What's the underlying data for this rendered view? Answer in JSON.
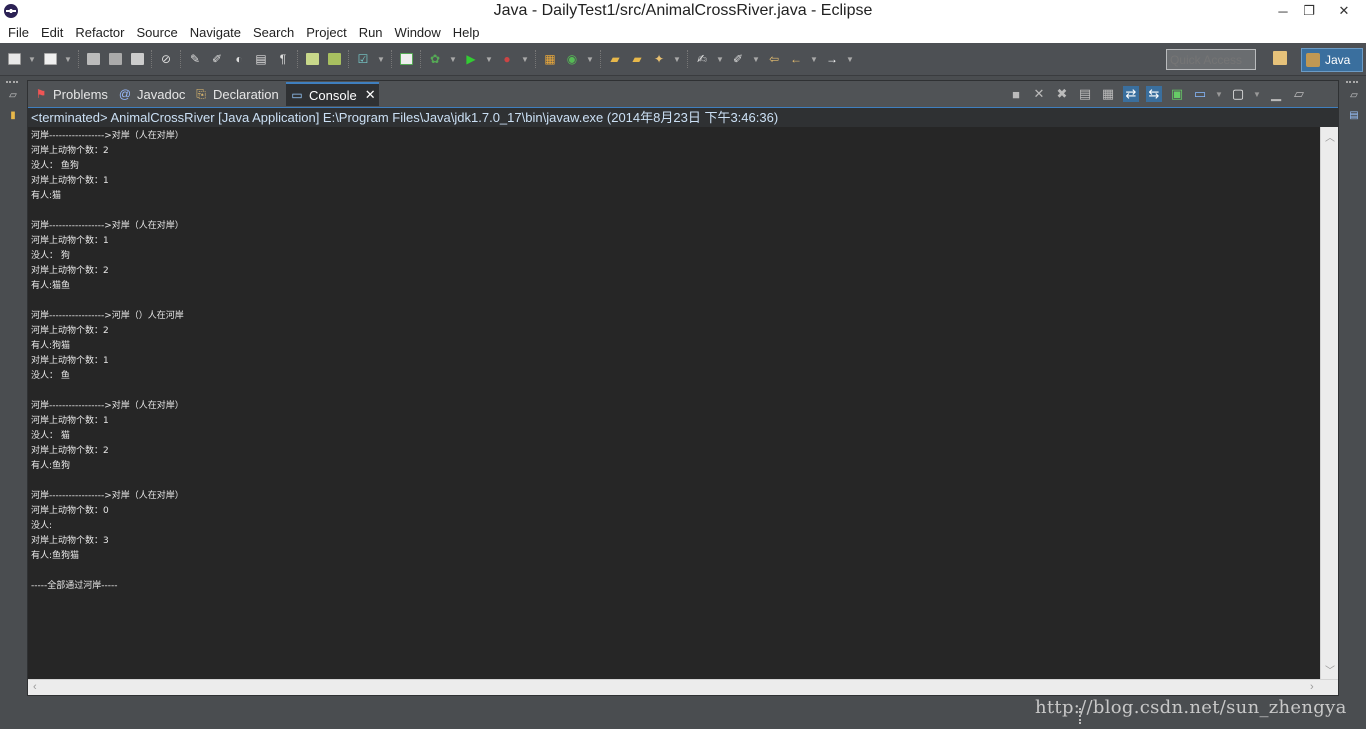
{
  "window": {
    "title": "Java - DailyTest1/src/AnimalCrossRiver.java - Eclipse",
    "buttons": {
      "minimize": "─",
      "restore": "❐",
      "close": "✕"
    }
  },
  "menubar": [
    "File",
    "Edit",
    "Refactor",
    "Source",
    "Navigate",
    "Search",
    "Project",
    "Run",
    "Window",
    "Help"
  ],
  "toolbar": {
    "quick_access_placeholder": "Quick Access",
    "perspective": "Java",
    "icons": [
      "new-icon",
      "save-icon",
      "save-all-icon",
      "print-icon",
      "skip-breakpoints-icon",
      "open-type-icon",
      "run-icon",
      "debug-icon",
      "external-tools-icon",
      "search-icon",
      "back-icon",
      "forward-icon"
    ]
  },
  "tabs": [
    {
      "label": "Problems",
      "icon": "problems-icon"
    },
    {
      "label": "Javadoc",
      "icon": "javadoc-icon"
    },
    {
      "label": "Declaration",
      "icon": "declaration-icon"
    },
    {
      "label": "Console",
      "icon": "console-icon",
      "active": true
    }
  ],
  "console": {
    "header": "<terminated> AnimalCrossRiver [Java Application] E:\\Program Files\\Java\\jdk1.7.0_17\\bin\\javaw.exe (2014年8月23日 下午3:46:36)",
    "lines": [
      "河岸----------------->对岸（人在对岸）",
      "河岸上动物个数：2",
      "没人： 鱼狗",
      "对岸上动物个数：1",
      "有人:猫",
      "",
      "河岸----------------->对岸（人在对岸）",
      "河岸上动物个数：1",
      "没人： 狗",
      "对岸上动物个数：2",
      "有人:猫鱼",
      "",
      "河岸----------------->河岸（）人在河岸",
      "河岸上动物个数：2",
      "有人:狗猫",
      "对岸上动物个数：1",
      "没人： 鱼",
      "",
      "河岸----------------->对岸（人在对岸）",
      "河岸上动物个数：1",
      "没人： 猫",
      "对岸上动物个数：2",
      "有人:鱼狗",
      "",
      "河岸----------------->对岸（人在对岸）",
      "河岸上动物个数：0",
      "没人:",
      "对岸上动物个数：3",
      "有人:鱼狗猫",
      "",
      "-----全部通过河岸-----"
    ]
  },
  "watermark": "http://blog.csdn.net/sun_zhengya"
}
